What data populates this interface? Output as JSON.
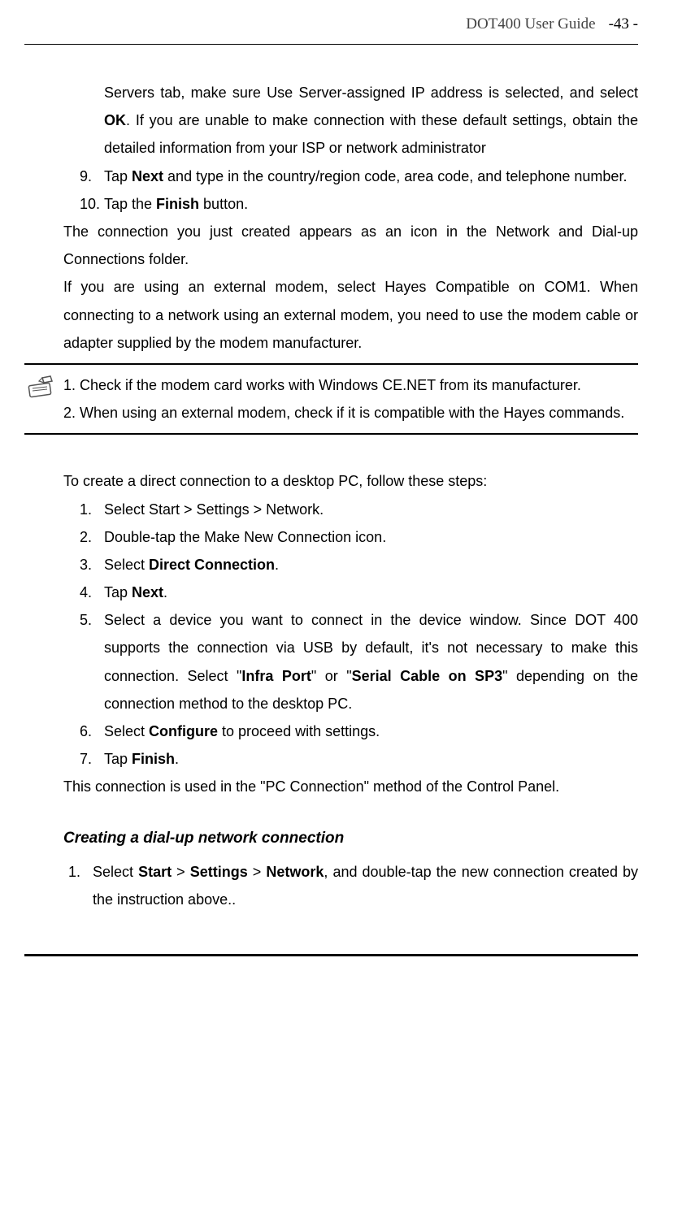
{
  "header": {
    "title": "DOT400 User Guide",
    "pageNum": "-43 -"
  },
  "section1": {
    "contPara": "Servers tab, make sure Use Server-assigned IP address is selected, and select ",
    "contBold": "OK",
    "contEnd": ". If you are unable to make connection with these default settings, obtain the detailed information from your ISP or network administrator",
    "item9num": "9.",
    "item9a": "Tap ",
    "item9bold": "Next",
    "item9b": " and type in the country/region code, area code, and telephone number.",
    "item10num": "10.",
    "item10a": "Tap the ",
    "item10bold": "Finish",
    "item10b": " button.",
    "para1": "The connection you just created appears as an icon in the Network and Dial-up Connections folder.",
    "para2": "If you are using an external modem, select Hayes Compatible on COM1. When connecting to a network using an external modem, you need to use the modem cable or adapter supplied by the modem manufacturer."
  },
  "note": {
    "n1": "1. Check if the modem card works with Windows CE.NET from its manufacturer.",
    "n2": "2. When using an external modem, check if it is compatible with the Hayes commands."
  },
  "section2": {
    "intro": "To create a direct connection to a desktop PC, follow these steps:",
    "i1num": "1.",
    "i1": "Select Start > Settings > Network.",
    "i2num": "2.",
    "i2": "Double-tap the Make New Connection icon.",
    "i3num": "3.",
    "i3a": "Select ",
    "i3bold": "Direct Connection",
    "i3b": ".",
    "i4num": "4.",
    "i4a": "Tap ",
    "i4bold": "Next",
    "i4b": ".",
    "i5num": "5.",
    "i5a": "Select a device you want to connect in the device window. Since DOT 400 supports the connection via USB by default, it's not necessary to make this connection. Select \"",
    "i5bold1": "Infra Port",
    "i5mid": "\" or \"",
    "i5bold2": "Serial Cable on SP3",
    "i5end": "\" depending on the connection method to the desktop PC.",
    "i6num": "6.",
    "i6a": "Select ",
    "i6bold": "Configure",
    "i6b": " to proceed with settings.",
    "i7num": "7.",
    "i7a": "Tap ",
    "i7bold": "Finish",
    "i7b": ".",
    "para": "This connection is used in the \"PC Connection\" method of the Control Panel."
  },
  "section3": {
    "heading": "Creating a dial-up network connection",
    "i1num": "1.",
    "i1a": "Select ",
    "i1b1": "Start",
    "i1m1": " > ",
    "i1b2": "Settings",
    "i1m2": " > ",
    "i1b3": "Network",
    "i1end": ", and double-tap the new connection created by the instruction above.."
  }
}
